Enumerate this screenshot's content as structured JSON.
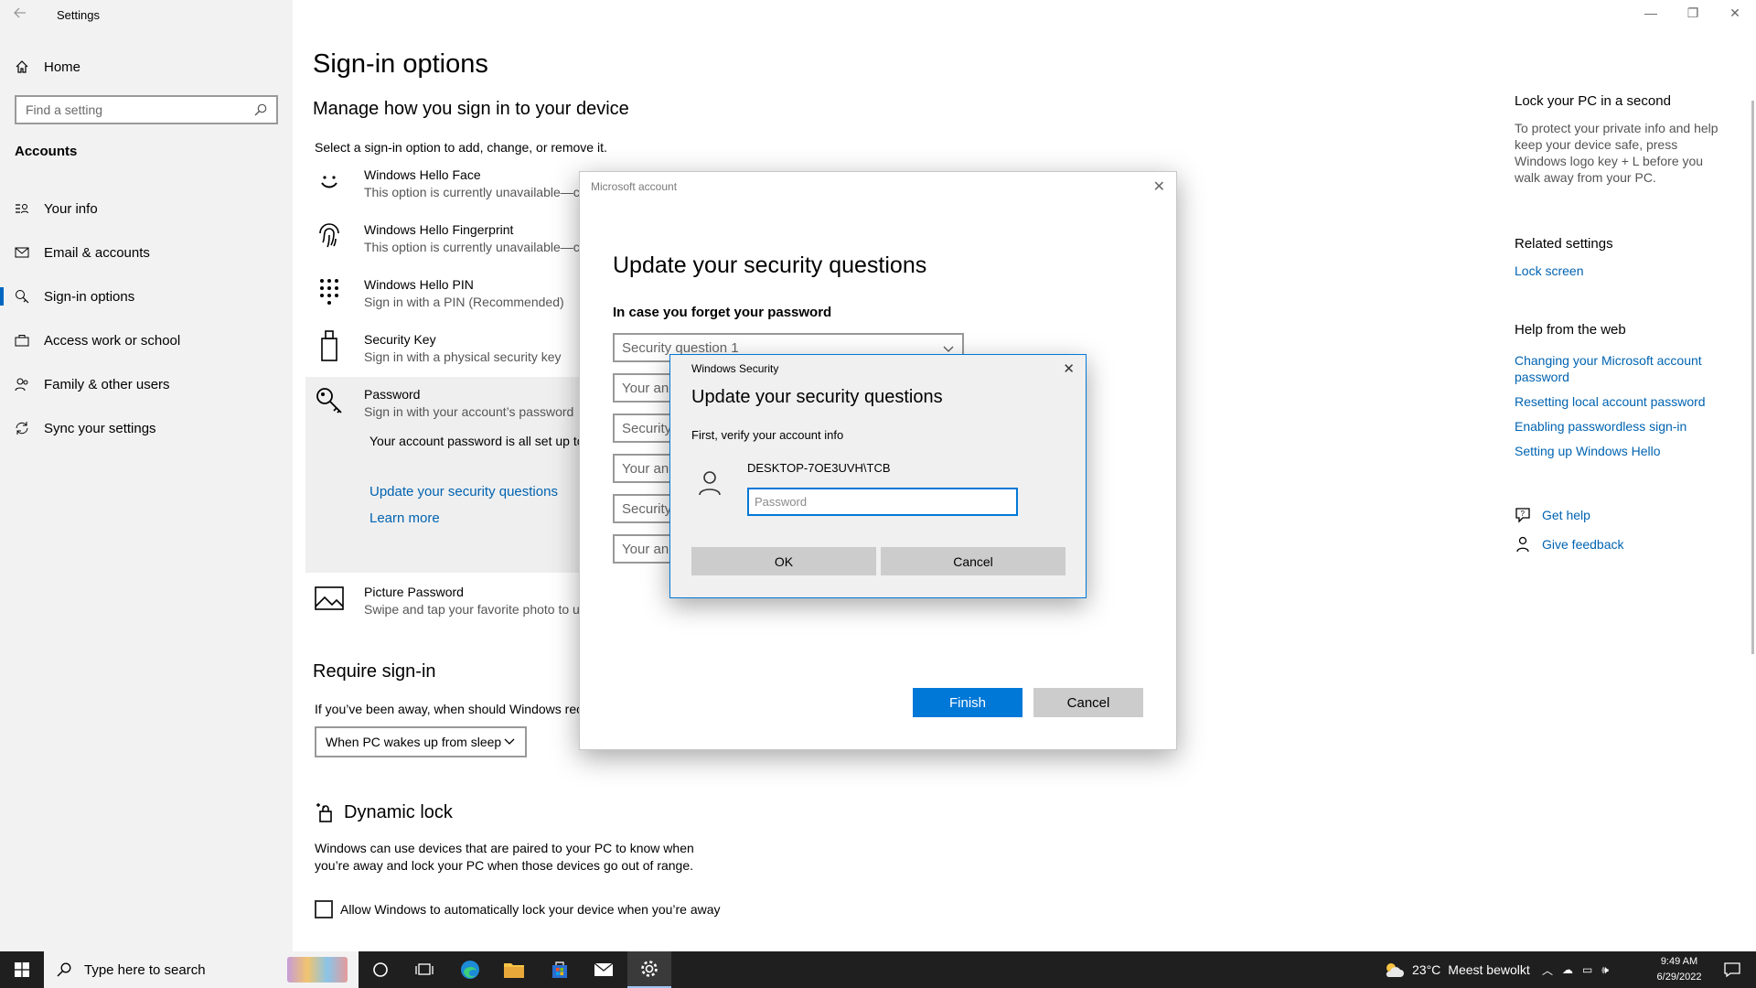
{
  "app": {
    "title": "Settings"
  },
  "sidebar": {
    "home": "Home",
    "search_placeholder": "Find a setting",
    "section": "Accounts",
    "items": [
      {
        "label": "Your info",
        "icon": "contact-card-icon"
      },
      {
        "label": "Email & accounts",
        "icon": "mail-icon"
      },
      {
        "label": "Sign-in options",
        "icon": "key-icon",
        "active": true
      },
      {
        "label": "Access work or school",
        "icon": "briefcase-icon"
      },
      {
        "label": "Family & other users",
        "icon": "people-icon"
      },
      {
        "label": "Sync your settings",
        "icon": "sync-icon"
      }
    ]
  },
  "main": {
    "title": "Sign-in options",
    "subtitle": "Manage how you sign in to your device",
    "hint": "Select a sign-in option to add, change, or remove it.",
    "options": [
      {
        "title": "Windows Hello Face",
        "desc": "This option is currently unavailable—cli"
      },
      {
        "title": "Windows Hello Fingerprint",
        "desc": "This option is currently unavailable—cli"
      },
      {
        "title": "Windows Hello PIN",
        "desc": "Sign in with a PIN (Recommended)"
      },
      {
        "title": "Security Key",
        "desc": "Sign in with a physical security key"
      },
      {
        "title": "Password",
        "desc": "Sign in with your account’s password"
      },
      {
        "title": "Picture Password",
        "desc": "Swipe and tap your favorite photo to ur"
      }
    ],
    "password_info": "Your account password is all set up to si apps, and services.",
    "password_link": "Update your security questions",
    "learn_more": "Learn more",
    "require_title": "Require sign-in",
    "require_text": "If you’ve been away, when should Windows rec",
    "require_value": "When PC wakes up from sleep",
    "dynamic_title": "Dynamic lock",
    "dynamic_text": "Windows can use devices that are paired to your PC to know when you’re away and lock your PC when those devices go out of range.",
    "dynamic_checkbox": "Allow Windows to automatically lock your device when you’re away"
  },
  "right": {
    "lock_title": "Lock your PC in a second",
    "lock_text": "To protect your private info and help keep your device safe, press Windows logo key + L before you walk away from your PC.",
    "related_title": "Related settings",
    "related_link": "Lock screen",
    "help_title": "Help from the web",
    "help_links": [
      "Changing your Microsoft account password",
      "Resetting local account password",
      "Enabling passwordless sign-in",
      "Setting up Windows Hello"
    ],
    "get_help": "Get help",
    "give_feedback": "Give feedback"
  },
  "ms_dialog": {
    "title": "Microsoft account",
    "heading": "Update your security questions",
    "sub": "In case you forget your password",
    "fields": [
      "Security question 1",
      "Your an",
      "Security",
      "Your an",
      "Security",
      "Your an"
    ],
    "finish": "Finish",
    "cancel": "Cancel"
  },
  "ws_dialog": {
    "title": "Windows Security",
    "heading": "Update your security questions",
    "sub": "First, verify your account info",
    "account": "DESKTOP-7OE3UVH\\TCB",
    "password_placeholder": "Password",
    "ok": "OK",
    "cancel": "Cancel"
  },
  "taskbar": {
    "search_placeholder": "Type here to search",
    "weather": "23°C",
    "weather_desc": "Meest bewolkt",
    "time": "9:49 AM",
    "date": "6/29/2022"
  },
  "colors": {
    "accent": "#0078d7",
    "link": "#0063b1",
    "sidebar_bg": "#f2f2f2"
  }
}
